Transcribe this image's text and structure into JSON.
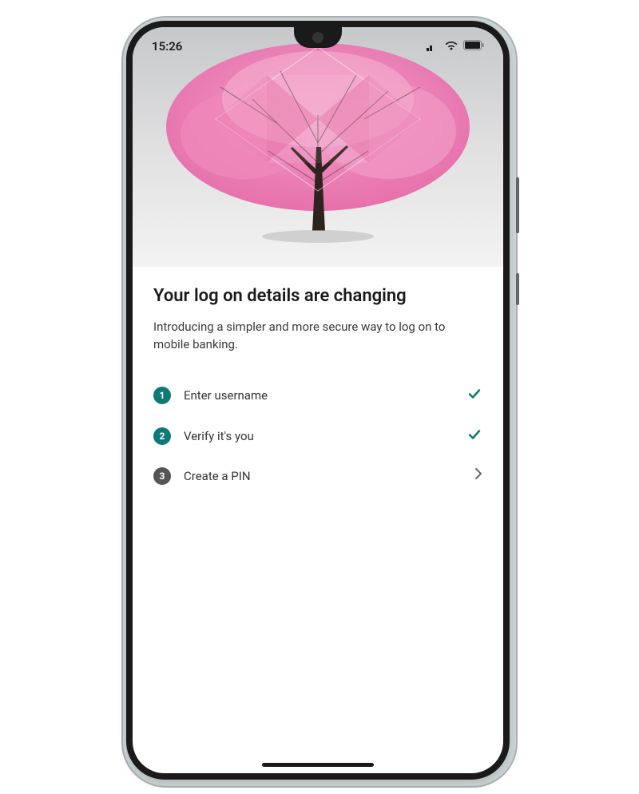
{
  "status": {
    "time": "15:26",
    "signal_bars_active": 2,
    "signal_bars_total": 4
  },
  "hero": {
    "description": "cherry-blossom-tree-with-geometric-overlay"
  },
  "page": {
    "title": "Your log on details are changing",
    "subtitle": "Introducing a simpler and more secure way to log on to mobile banking."
  },
  "steps": [
    {
      "num": "1",
      "label": "Enter username",
      "state": "done",
      "action_icon": "check"
    },
    {
      "num": "2",
      "label": "Verify it's you",
      "state": "done",
      "action_icon": "check"
    },
    {
      "num": "3",
      "label": "Create a PIN",
      "state": "current",
      "action_icon": "chevron-right"
    }
  ],
  "colors": {
    "teal": "#0d7a78",
    "grey_circle": "#555"
  }
}
